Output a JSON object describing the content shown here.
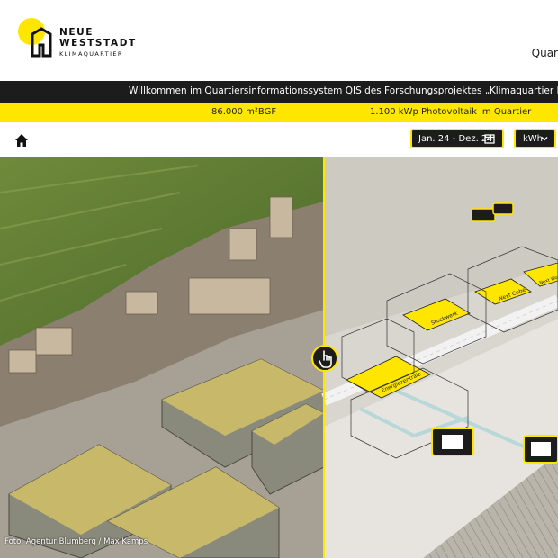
{
  "header": {
    "logo": {
      "line1": "NEUE",
      "line2": "WESTSTADT",
      "line3": "KLIMAQUARTIER"
    },
    "nav_partial": "Quar"
  },
  "banner": {
    "welcome_text": "Willkommen im Quartiersinformationssystem QIS des Forschungsprojektes „Klimaquartier Neue Weststadt\""
  },
  "stats": {
    "gross_floor_area": "86.000 m²BGF",
    "photovoltaics": "1.100 kWp Photovoltaik im Quartier"
  },
  "toolbar": {
    "home_icon": "home-icon",
    "date_range": "Jan. 24 - Dez. 24",
    "calendar_icon": "calendar-icon",
    "unit": "kWh",
    "chevron_icon": "chevron-down-icon"
  },
  "image": {
    "photo_credit": "Foto: Agentur Blumberg / Max Kamps",
    "handle_icon": "hand-pointer-icon",
    "building_labels": [
      "Energiezentrale",
      "Stockwerk",
      "Next Cube",
      "Next Work"
    ]
  },
  "colors": {
    "accent": "#ffe600",
    "dark": "#1c1c1c"
  }
}
